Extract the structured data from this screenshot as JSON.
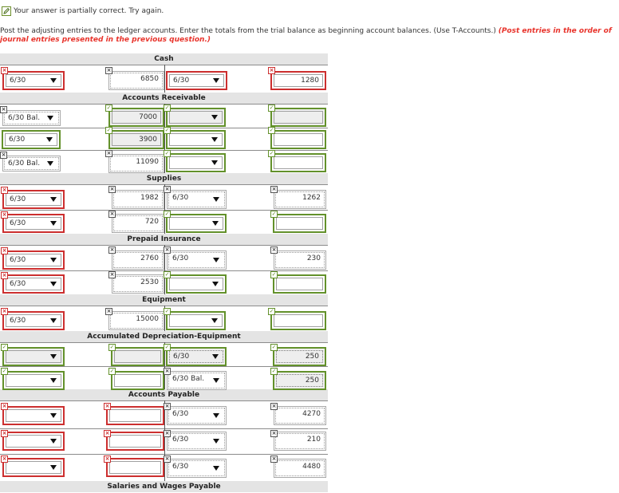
{
  "status": {
    "text": "Your answer is partially correct.  Try again."
  },
  "instructions": {
    "main": "Post the adjusting entries to the ledger accounts. Enter the totals from the trial balance as beginning account balances. (Use T-Accounts.) ",
    "red": "(Post entries in the order of journal entries presented in the previous question.)"
  },
  "accounts": [
    {
      "name": "Cash"
    },
    {
      "name": "Accounts Receivable"
    },
    {
      "name": "Supplies"
    },
    {
      "name": "Prepaid Insurance"
    },
    {
      "name": "Equipment"
    },
    {
      "name": "Accumulated Depreciation-Equipment"
    },
    {
      "name": "Accounts Payable"
    },
    {
      "name": "Salaries and Wages Payable"
    }
  ],
  "rows": [
    {
      "ld": "6/30",
      "la": "6850",
      "rd": "6/30",
      "ra": "1280"
    },
    {
      "ld": "6/30 Bal.",
      "la": "7000",
      "rd": "",
      "ra": ""
    },
    {
      "ld": "6/30",
      "la": "3900",
      "rd": "",
      "ra": ""
    },
    {
      "ld": "6/30 Bal.",
      "la": "11090",
      "rd": "",
      "ra": ""
    },
    {
      "ld": "6/30",
      "la": "1982",
      "rd": "6/30",
      "ra": "1262"
    },
    {
      "ld": "6/30",
      "la": "720",
      "rd": "",
      "ra": ""
    },
    {
      "ld": "6/30",
      "la": "2760",
      "rd": "6/30",
      "ra": "230"
    },
    {
      "ld": "6/30",
      "la": "2530",
      "rd": "",
      "ra": ""
    },
    {
      "ld": "6/30",
      "la": "15000",
      "rd": "",
      "ra": ""
    },
    {
      "ld": "",
      "la": "",
      "rd": "6/30",
      "ra": "250"
    },
    {
      "ld": "",
      "la": "",
      "rd": "6/30 Bal.",
      "ra": "250"
    },
    {
      "ld": "",
      "la": "",
      "rd": "6/30",
      "ra": "4270"
    },
    {
      "ld": "",
      "la": "",
      "rd": "6/30",
      "ra": "210"
    },
    {
      "ld": "",
      "la": "",
      "rd": "6/30",
      "ra": "4480"
    }
  ]
}
